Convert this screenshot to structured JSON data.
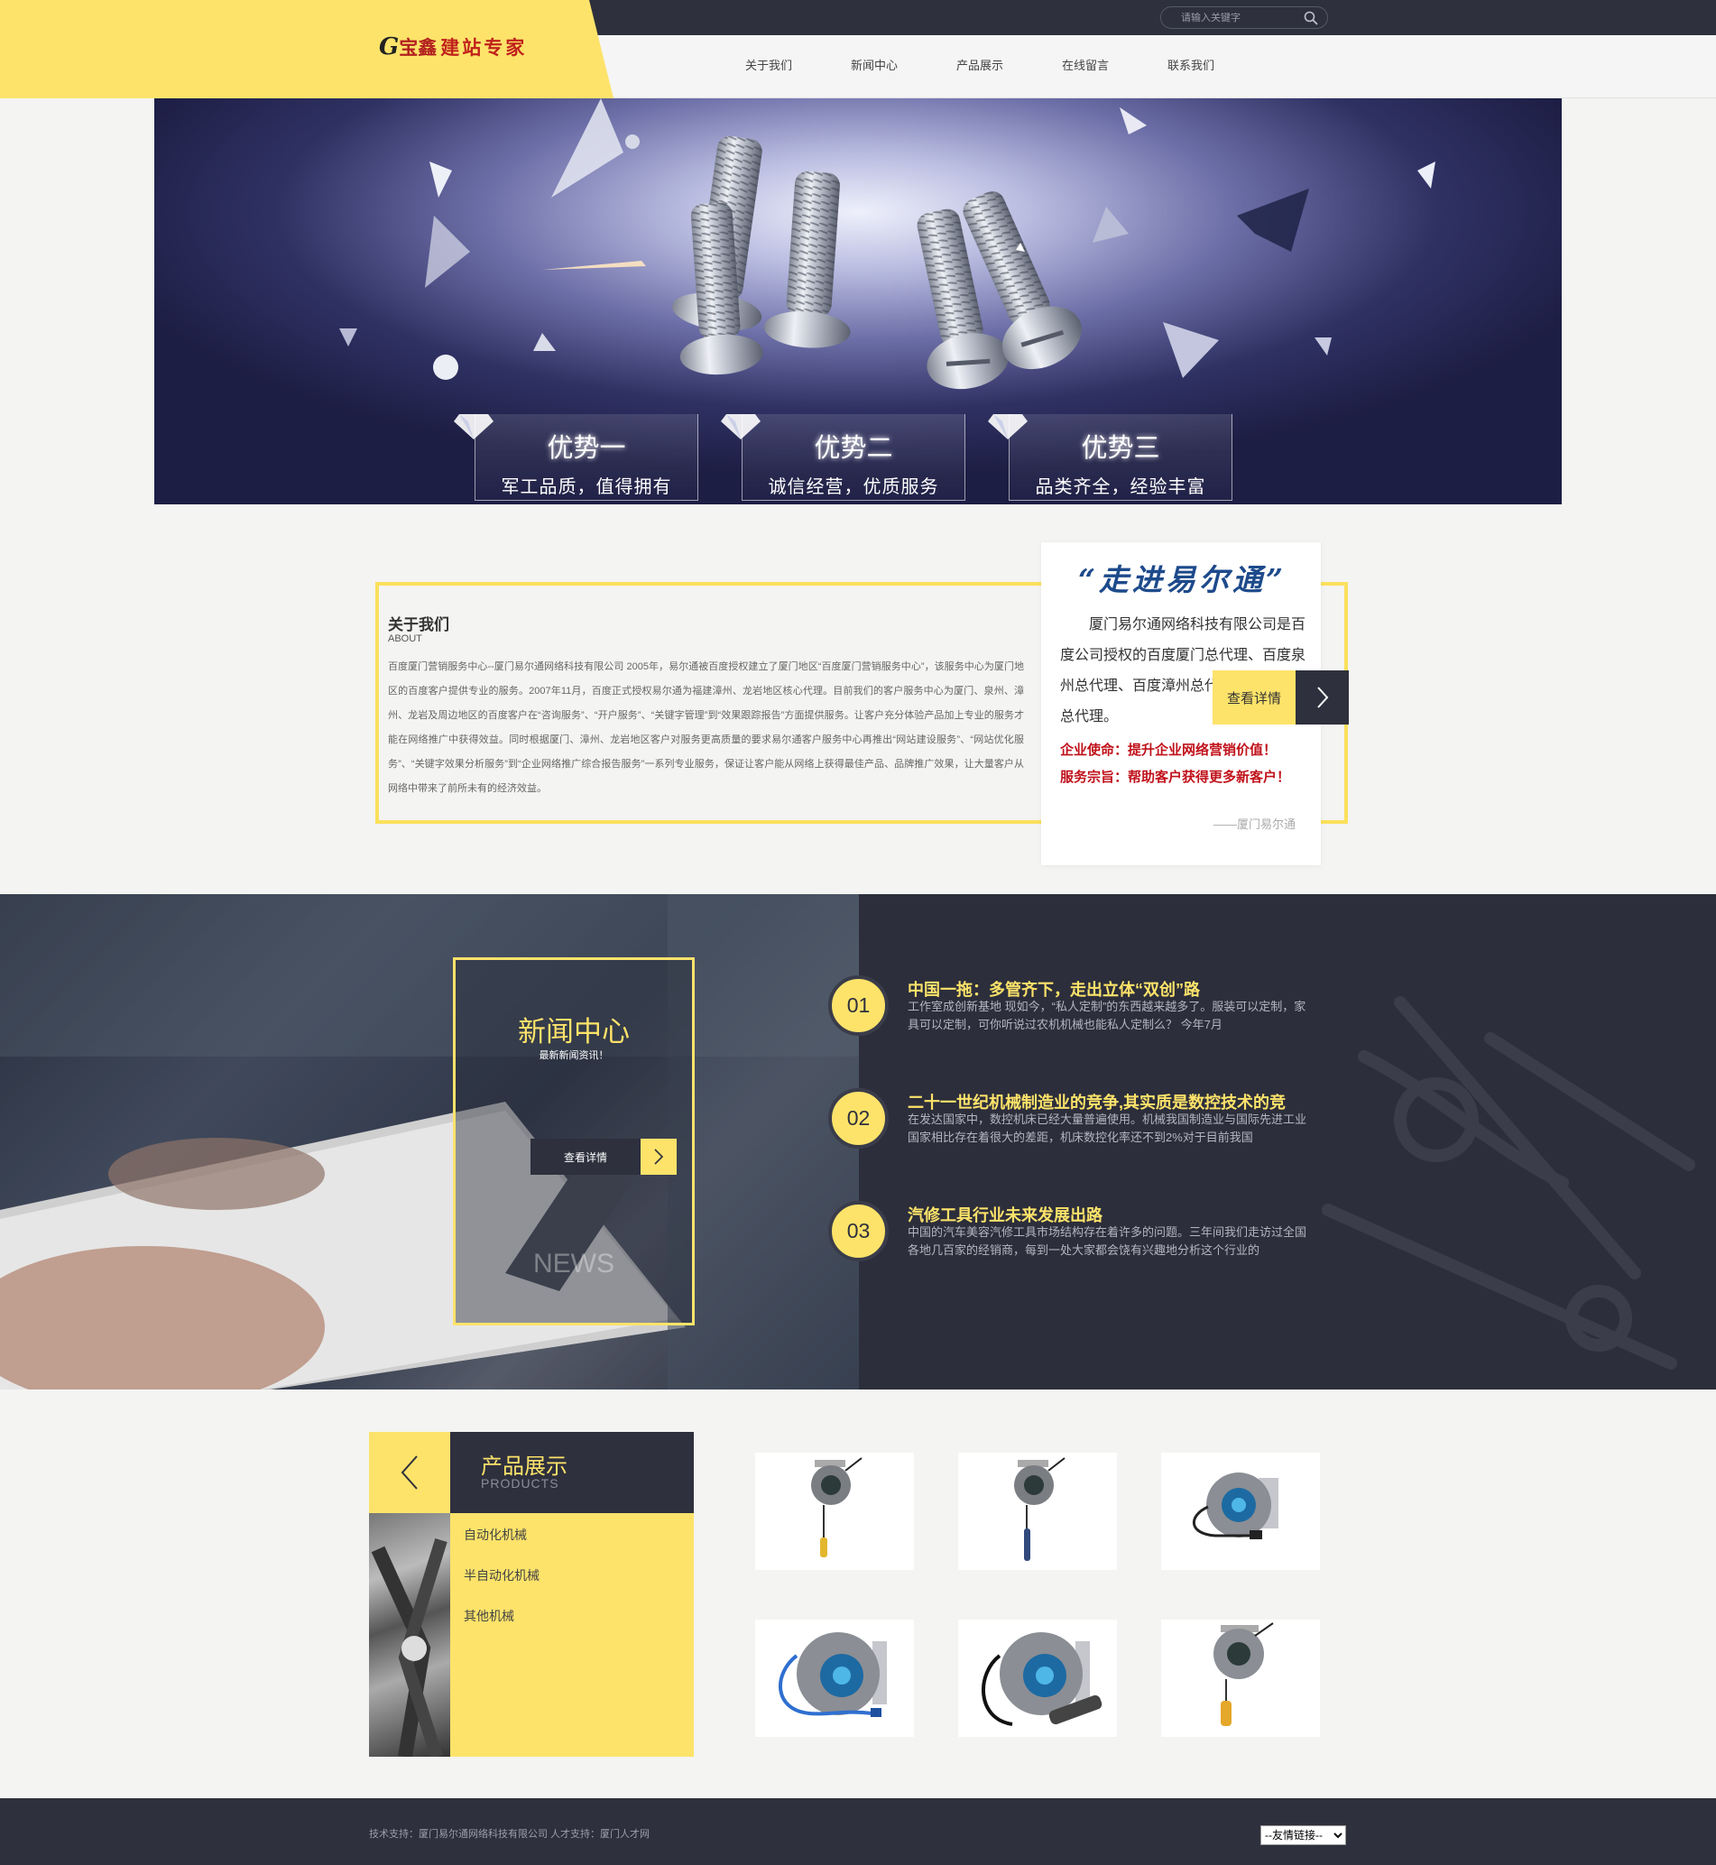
{
  "header": {
    "logo_mark": "宝鑫",
    "logo_text": "建站专家",
    "search_placeholder": "请输入关键字",
    "nav": [
      "关于我们",
      "新闻中心",
      "产品展示",
      "在线留言",
      "联系我们"
    ]
  },
  "banner": {
    "advantages": [
      {
        "title": "优势一",
        "desc": "军工品质，值得拥有"
      },
      {
        "title": "优势二",
        "desc": "诚信经营，优质服务"
      },
      {
        "title": "优势三",
        "desc": "品类齐全，经验丰富"
      }
    ]
  },
  "about": {
    "title": "关于我们",
    "subtitle": "ABOUT",
    "text": "百度厦门营销服务中心--厦门易尔通网络科技有限公司 2005年，易尔通被百度授权建立了厦门地区“百度厦门营销服务中心”，该服务中心为厦门地区的百度客户提供专业的服务。2007年11月，百度正式授权易尔通为福建漳州、龙岩地区核心代理。目前我们的客户服务中心为厦门、泉州、漳州、龙岩及周边地区的百度客户在“咨询服务”、“开户服务”、“关键字管理”到“效果跟踪报告”方面提供服务。让客户充分体验产品加上专业的服务才能在网络推广中获得效益。同时根据厦门、漳州、龙岩地区客户对服务更高质量的要求易尔通客户服务中心再推出“网站建设服务”、“网站优化服务”、“关键字效果分析服务”到“企业网络推广综合报告服务”一系列专业服务，保证让客户能从网络上获得最佳产品、品牌推广效果，让大量客户从网络中带来了前所未有的经济效益。",
    "intro_title": "“走进易尔通”",
    "intro_text": "厦门易尔通网络科技有限公司是百度公司授权的百度厦门总代理、百度泉州总代理、百度漳州总代理、百度龙岩总代理。",
    "mission": "企业使命：提升企业网络营销价值！",
    "purpose": "服务宗旨：帮助客户获得更多新客户！",
    "signature": "——厦门易尔通",
    "more_label": "查看详情"
  },
  "news": {
    "heading": "新闻中心",
    "subheading": "最新新闻资讯！",
    "more_label": "查看详情",
    "watermark": "NEWS",
    "items": [
      {
        "num": "01",
        "title": "中国一拖：多管齐下，走出立体“双创”路",
        "desc": "工作室成创新基地 现如今，“私人定制”的东西越来越多了。服装可以定制，家具可以定制，可你听说过农机机械也能私人定制么？ 今年7月"
      },
      {
        "num": "02",
        "title": "二十一世纪机械制造业的竞争,其实质是数控技术的竞",
        "desc": "在发达国家中，数控机床已经大量普遍使用。机械我国制造业与国际先进工业国家相比存在着很大的差距，机床数控化率还不到2%对于目前我国"
      },
      {
        "num": "03",
        "title": "汽修工具行业未来发展出路",
        "desc": "中国的汽车美容汽修工具市场结构存在着许多的问题。三年间我们走访过全国各地几百家的经销商，每到一处大家都会饶有兴趣地分析这个行业的"
      }
    ]
  },
  "products": {
    "title": "产品展示",
    "subtitle": "PRODUCTS",
    "categories": [
      "自动化机械",
      "半自动化机械",
      "其他机械"
    ]
  },
  "footer": {
    "text": "技术支持：厦门易尔通网络科技有限公司 人才支持：厦门人才网",
    "friend_links": "--友情链接--"
  },
  "colors": {
    "accent": "#fde36a",
    "dark": "#2e303d",
    "red": "#c0111a"
  }
}
